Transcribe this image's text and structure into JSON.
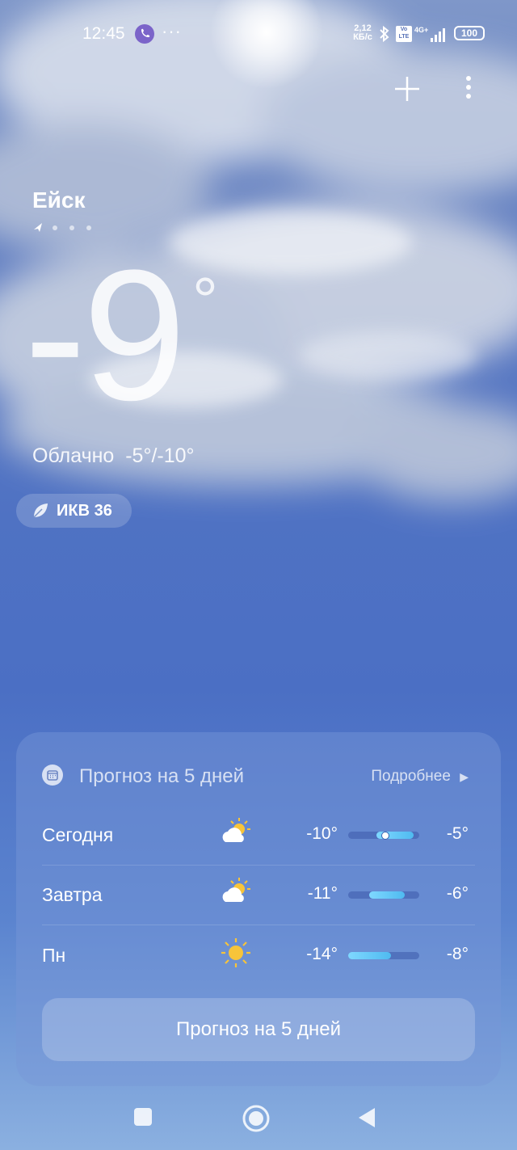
{
  "status": {
    "time": "12:45",
    "more": "···",
    "speed_value": "2,12",
    "speed_unit": "КБ/с",
    "volte": "Vo LTE",
    "network": "4G+",
    "battery": "100"
  },
  "location": {
    "city": "Ейск"
  },
  "current": {
    "temperature": "-9",
    "degree": "°",
    "condition": "Облачно",
    "range": "-5°/-10°",
    "aqi_label": "ИКВ 36"
  },
  "forecast": {
    "title": "Прогноз на 5 дней",
    "more_label": "Подробнее",
    "button_label": "Прогноз на 5 дней",
    "days": [
      {
        "day": "Сегодня",
        "icon": "partly-cloudy-icon",
        "low": "-10°",
        "high": "-5°",
        "bar_start": 0.4,
        "bar_end": 0.92,
        "current_marker": 0.52
      },
      {
        "day": "Завтра",
        "icon": "partly-cloudy-icon",
        "low": "-11°",
        "high": "-6°",
        "bar_start": 0.3,
        "bar_end": 0.8
      },
      {
        "day": "Пн",
        "icon": "sun-icon",
        "low": "-14°",
        "high": "-8°",
        "bar_start": 0.0,
        "bar_end": 0.6
      }
    ]
  },
  "colors": {
    "accent_bar": "#5ec4f5",
    "card_bg": "#7896d7"
  }
}
